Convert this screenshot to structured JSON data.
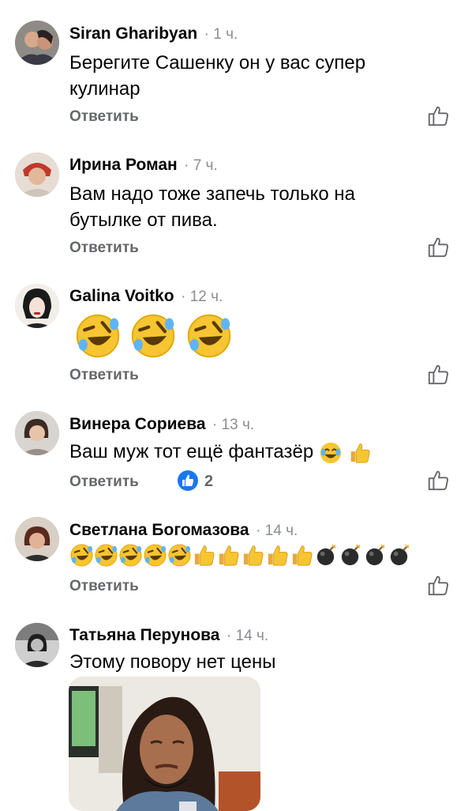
{
  "comments": [
    {
      "name": "Siran Gharibyan",
      "time": "· 1 ч.",
      "text_lines": [
        "Берегите Сашенку он у вас супер",
        "кулинар"
      ],
      "reply": "Ответить"
    },
    {
      "name": "Ирина Роман",
      "time": "· 7 ч.",
      "text_lines": [
        "Вам надо тоже запечь только на",
        "бутылке от пива."
      ],
      "reply": "Ответить"
    },
    {
      "name": "Galina Voitko",
      "time": "· 12 ч.",
      "emojis": [
        "rofl-emoji",
        "rofl-emoji",
        "rofl-emoji"
      ],
      "reply": "Ответить"
    },
    {
      "name": "Винера Сориева",
      "time": "· 13 ч.",
      "text_lines": [
        "Ваш муж тот ещё фантазёр"
      ],
      "reaction_count": "2",
      "reply": "Ответить"
    },
    {
      "name": "Светлана Богомазова",
      "time": "· 14 ч.",
      "reply": "Ответить"
    },
    {
      "name": "Татьяна Перунова",
      "time": "· 14 ч.",
      "text_lines": [
        "Этому повору нет цены"
      ]
    }
  ],
  "colors": {
    "name": "#050505",
    "meta": "#65676b",
    "time": "#8a8d91",
    "like_blue": "#1877f2",
    "emoji_yellow": "#f7c531"
  }
}
